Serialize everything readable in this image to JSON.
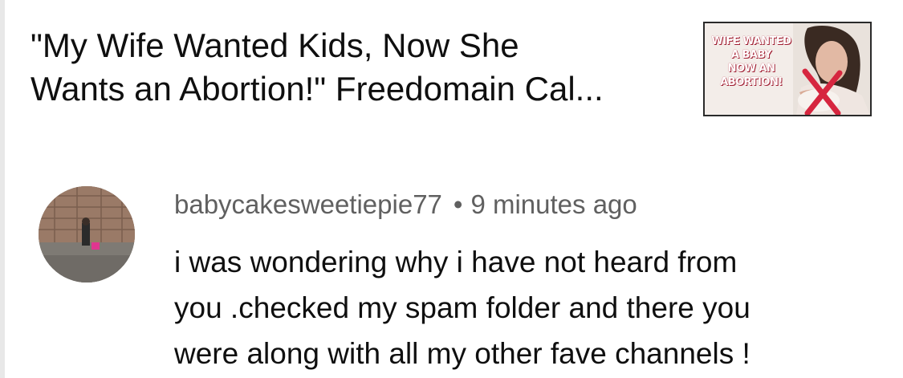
{
  "video": {
    "title": "\"My Wife Wanted Kids, Now She\nWants an Abortion!\" Freedomain Cal...",
    "thumbnail_text": "WIFE WANTED\nA BABY\nNOW AN\nABORTION!",
    "thumbnail_accent_color": "#d6263f"
  },
  "comment": {
    "author": "babycakesweetiepie77",
    "separator": "•",
    "timestamp": "9 minutes ago",
    "text": "i was wondering why i have not heard from\nyou .checked my spam folder and there you\nwere along with all my other fave channels !"
  }
}
